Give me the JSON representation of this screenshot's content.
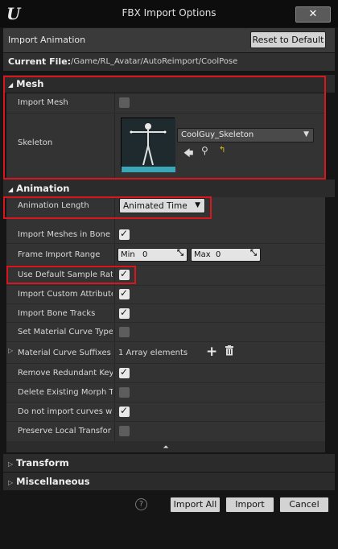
{
  "window": {
    "title": "FBX Import Options",
    "close_label": "✕"
  },
  "header": {
    "label": "Import Animation",
    "reset_label": "Reset to Default"
  },
  "current_file": {
    "label": "Current File:",
    "path": "/Game/RL_Avatar/AutoReimport/CoolPose"
  },
  "mesh": {
    "heading": "Mesh",
    "import_mesh_label": "Import Mesh",
    "import_mesh_checked": false,
    "skeleton_label": "Skeleton",
    "skeleton_value": "CoolGuy_Skeleton"
  },
  "animation": {
    "heading": "Animation",
    "length_label": "Animation Length",
    "length_value": "Animated Time",
    "rows": [
      {
        "label": "Import Meshes in Bone H",
        "checked": true
      },
      {
        "label": "Frame Import Range"
      },
      {
        "label": "Use Default Sample Rate",
        "checked": true
      },
      {
        "label": "Import Custom Attribute",
        "checked": true
      },
      {
        "label": "Import Bone Tracks",
        "checked": true
      },
      {
        "label": "Set Material Curve Type",
        "checked": false
      },
      {
        "label": "Material Curve Suffixes",
        "value": "1 Array elements"
      },
      {
        "label": "Remove Redundant Keys",
        "checked": true
      },
      {
        "label": "Delete Existing Morph Ta",
        "checked": false
      },
      {
        "label": "Do not import curves wit",
        "checked": true
      },
      {
        "label": "Preserve Local Transfor",
        "checked": false
      }
    ],
    "range_min_label": "Min",
    "range_min_value": "0",
    "range_max_label": "Max",
    "range_max_value": "0"
  },
  "sections": {
    "transform": "Transform",
    "misc": "Miscellaneous"
  },
  "footer": {
    "import_all": "Import All",
    "import": "Import",
    "cancel": "Cancel"
  }
}
